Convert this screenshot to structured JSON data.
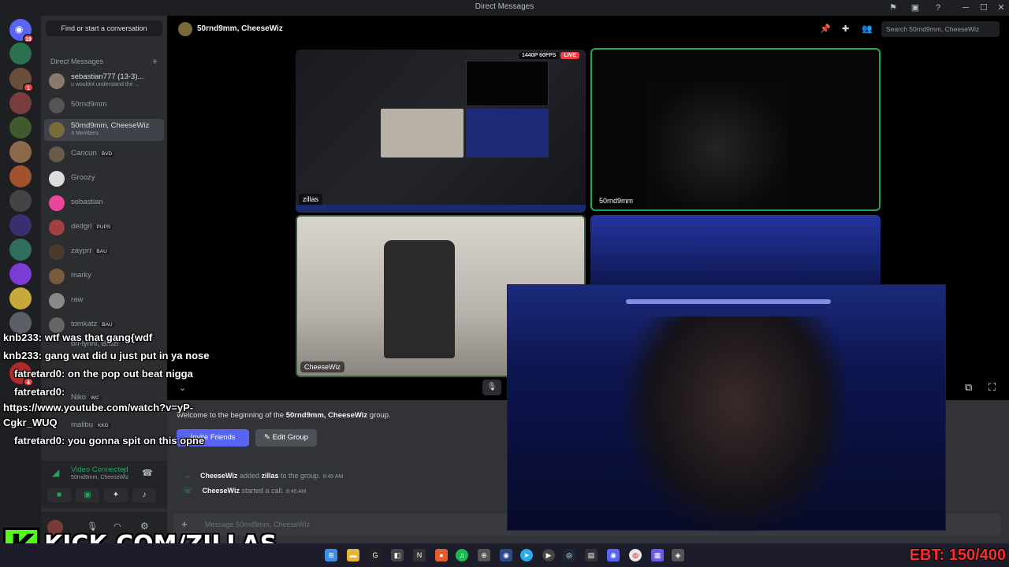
{
  "titlebar": {
    "title": "Direct Messages",
    "icons": [
      "inbox-icon",
      "screen-icon",
      "help-icon"
    ],
    "minimize": "─",
    "maximize": "☐",
    "close": "✕"
  },
  "guilds": {
    "home_badge": "19",
    "second_badge": "1",
    "third_badge": "4"
  },
  "dm_list": {
    "search_label": "Find or start a conversation",
    "header": "Direct Messages",
    "plus": "+",
    "items": [
      {
        "name": "sebastian777 (13-3)...",
        "sub": "u wouldnt understand the ..."
      },
      {
        "name": "50rnd9mm"
      },
      {
        "name": "50rnd9mm, CheeseWiz",
        "sub": "3 Members"
      },
      {
        "name": "Cancun",
        "tag": "BVD"
      },
      {
        "name": "Groozy"
      },
      {
        "name": "sebastian"
      },
      {
        "name": "dedgrl",
        "tag": "PUPS"
      },
      {
        "name": "zayprr",
        "tag": "BAU"
      },
      {
        "name": "marky"
      },
      {
        "name": "raw"
      },
      {
        "name": "tomkatz",
        "tag": "BAU"
      },
      {
        "name": "bri-lynnl, Bruzi"
      },
      {
        "name": "Niko",
        "tag": "WC"
      },
      {
        "name": "malibu",
        "tag": "KKG"
      }
    ]
  },
  "voice_panel": {
    "status": "Video Connected",
    "channel": "50rnd9mm, CheeseWiz"
  },
  "channel": {
    "name": "50rnd9mm, CheeseWiz",
    "search_placeholder": "Search 50rnd9mm, CheeseWiz"
  },
  "tiles": {
    "stream_label": "zillas",
    "stream_quality": "1440P 60FPS",
    "live": "LIVE",
    "cam1_label": "50rnd9mm",
    "cam2_label": "CheeseWiz"
  },
  "messages": {
    "welcome_prefix": "Welcome to the beginning of the ",
    "welcome_group": "50rnd9mm, CheeseWiz",
    "welcome_suffix": " group.",
    "invite_label": "Invite Friends",
    "edit_label": "Edit Group",
    "sys1_actor": "CheeseWiz",
    "sys1_text": " added ",
    "sys1_target": "zillas",
    "sys1_suffix": " to the group.",
    "sys1_time": "8:45 AM",
    "sys2_actor": "CheeseWiz",
    "sys2_text": " started a call.",
    "sys2_time": "8:45 AM",
    "composer_placeholder": "Message 50rnd9mm, CheeseWiz"
  },
  "chat_overlay": [
    "knb233: wtf was that gang{wdf",
    "knb233: gang wat did u just put in ya nose",
    "fatretard0: on the pop out beat nigga",
    "fatretard0:",
    "https://www.youtube.com/watch?v=yP-",
    "Cgkr_WUQ",
    "fatretard0: you gonna spit on this opne"
  ],
  "kick": {
    "logo": "K",
    "url": "KICK.COM/ZILLAS"
  },
  "ebt_counter": "EBT: 150/400"
}
